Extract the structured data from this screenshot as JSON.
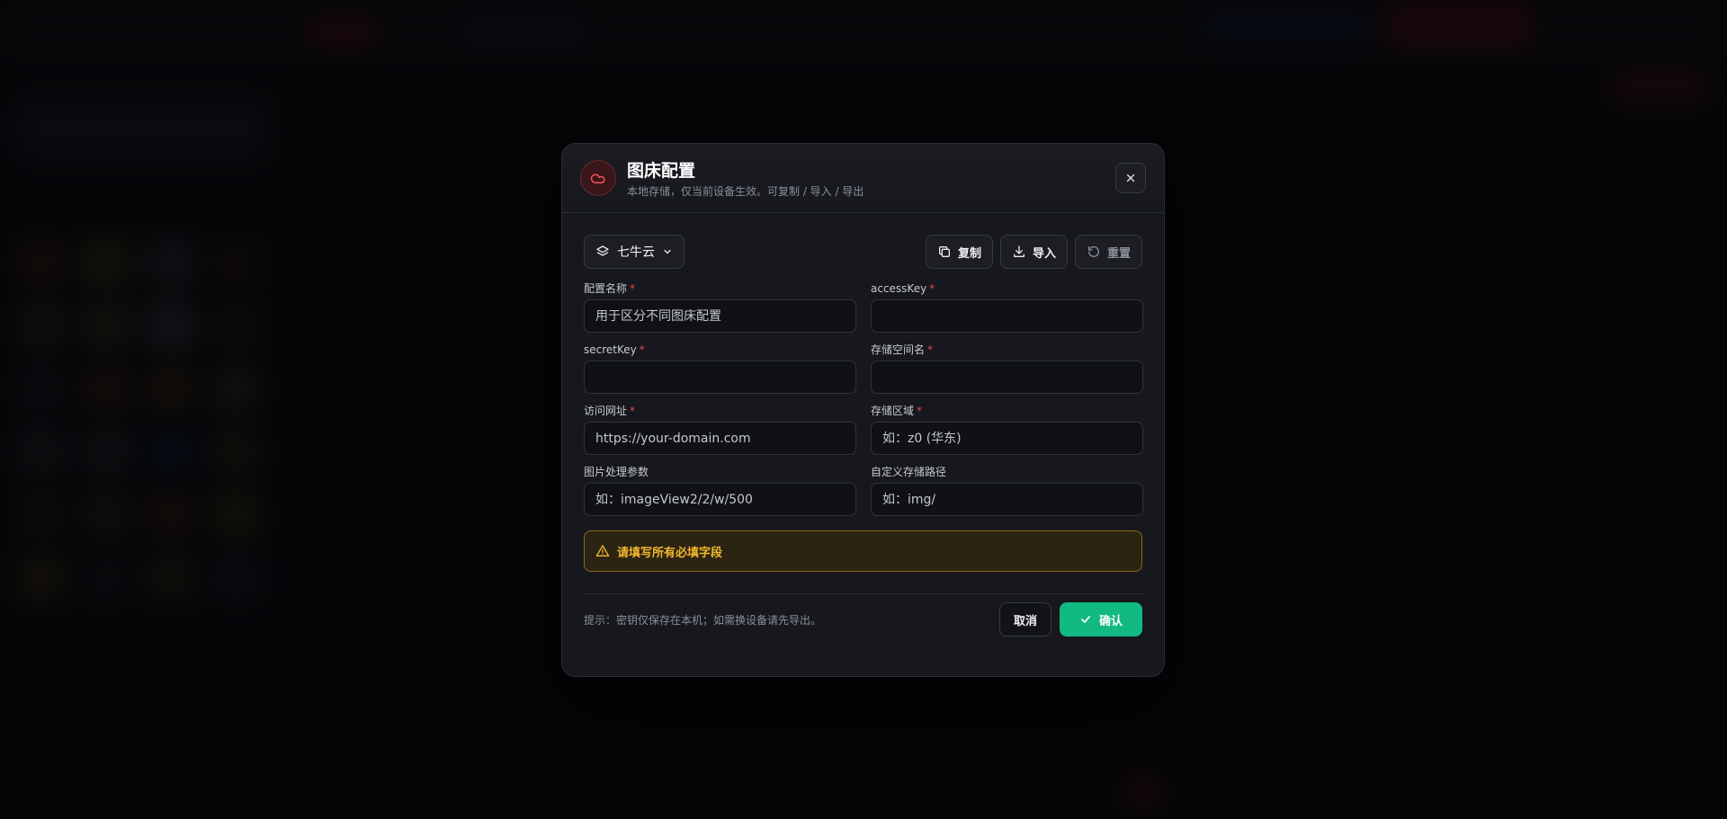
{
  "dialog": {
    "title": "图床配置",
    "subtitle": "本地存储，仅当前设备生效。可复制 / 导入 / 导出",
    "logo_icon": "cloud-icon",
    "close_icon": "close-icon"
  },
  "toolbar": {
    "provider": "七牛云",
    "copy_label": "复制",
    "import_label": "导入",
    "reset_label": "重置"
  },
  "fields": {
    "config_name": {
      "label": "配置名称",
      "placeholder": "用于区分不同图床配置",
      "value": ""
    },
    "access_key": {
      "label": "accessKey",
      "placeholder": "",
      "value": ""
    },
    "secret_key": {
      "label": "secretKey",
      "placeholder": "",
      "value": ""
    },
    "bucket": {
      "label": "存储空间名",
      "placeholder": "",
      "value": ""
    },
    "url": {
      "label": "访问网址",
      "placeholder": "https://your-domain.com",
      "value": ""
    },
    "region": {
      "label": "存储区域",
      "placeholder": "如：z0 (华东)",
      "value": ""
    },
    "image_params": {
      "label": "图片处理参数",
      "placeholder": "如：imageView2/2/w/500",
      "value": ""
    },
    "path": {
      "label": "自定义存储路径",
      "placeholder": "如：img/",
      "value": ""
    }
  },
  "required_mark": "*",
  "warning": {
    "text": "请填写所有必填字段"
  },
  "footer": {
    "hint": "提示：密钥仅保存在本机；如需换设备请先导出。",
    "cancel_label": "取消",
    "confirm_label": "确认"
  },
  "colors": {
    "accent": "#12b981",
    "danger": "#e5484d",
    "warning": "#f5b82e"
  }
}
